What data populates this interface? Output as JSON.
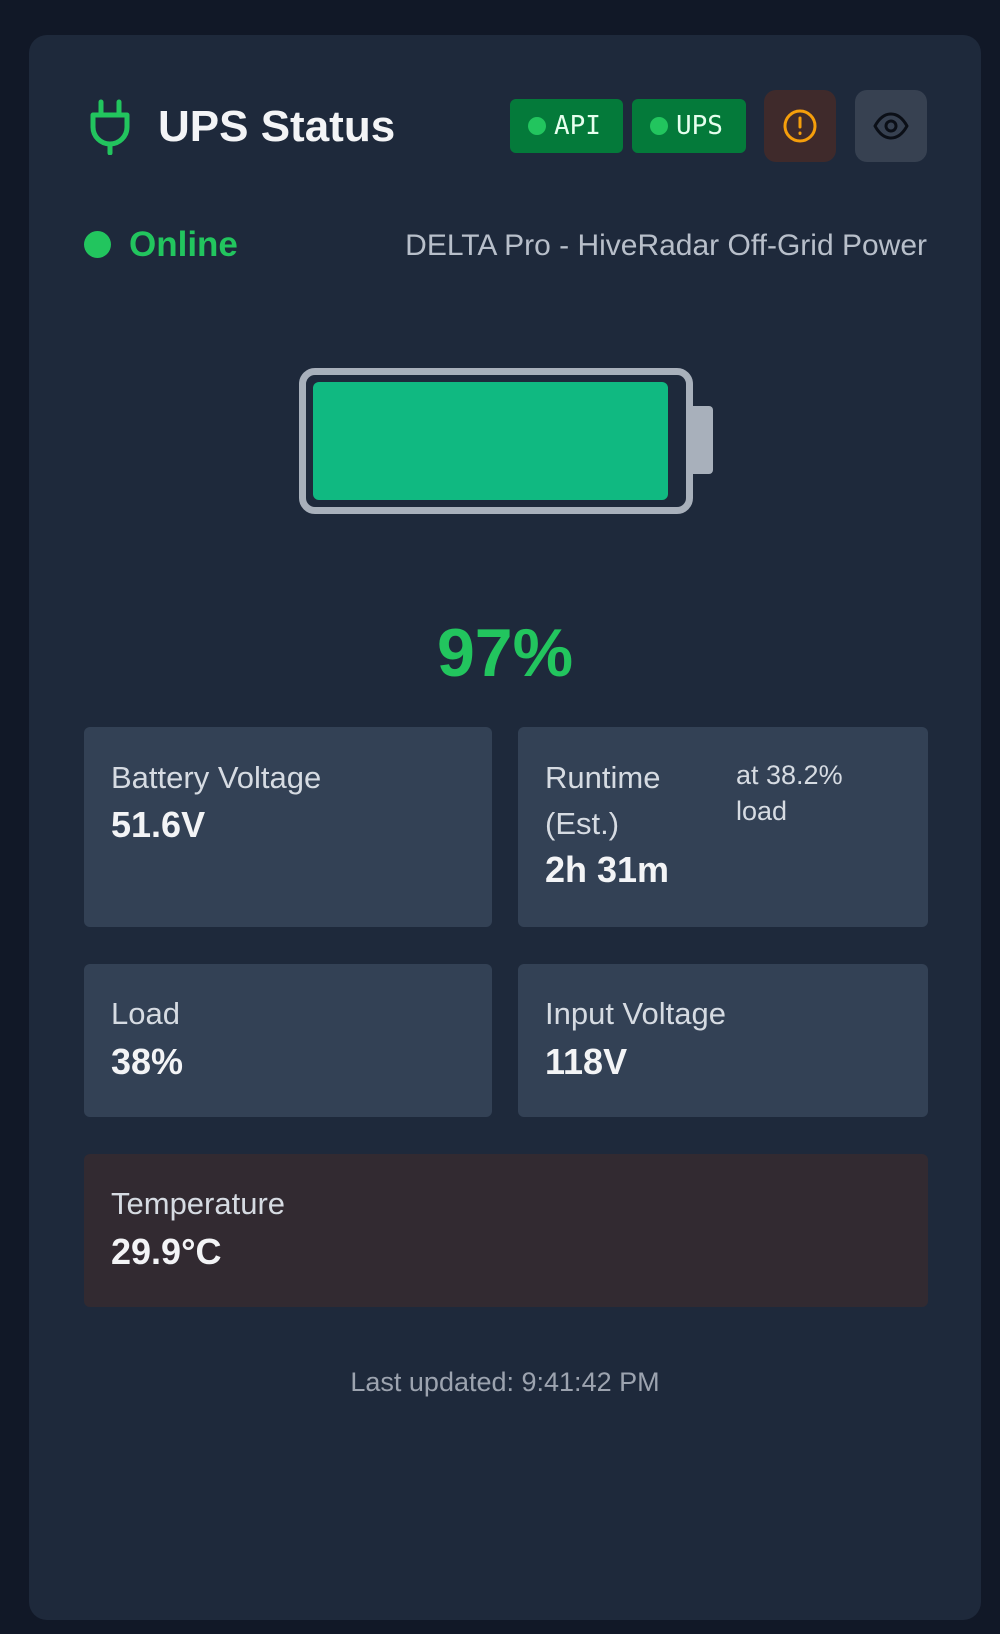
{
  "header": {
    "title": "UPS Status",
    "icon": "plug-icon",
    "badges": [
      {
        "label": "API",
        "status_color": "#22c55e"
      },
      {
        "label": "UPS",
        "status_color": "#22c55e"
      }
    ],
    "warning_icon": "alert-circle-icon",
    "visibility_icon": "eye-icon"
  },
  "status": {
    "state": "Online",
    "device": "DELTA Pro - HiveRadar Off-Grid Power",
    "color": "#22c55e"
  },
  "battery": {
    "charge_fraction": 0.97,
    "percent_label": "97%",
    "fill_color": "#10b981"
  },
  "stats": {
    "battery_voltage": {
      "label": "Battery Voltage",
      "value": "51.6V"
    },
    "runtime": {
      "label": "Runtime (Est.)",
      "value": "2h 31m",
      "note": "at 38.2% load"
    },
    "load": {
      "label": "Load",
      "value": "38%"
    },
    "input_voltage": {
      "label": "Input Voltage",
      "value": "118V"
    },
    "temperature": {
      "label": "Temperature",
      "value": "29.9°C"
    }
  },
  "footer": {
    "last_updated": "Last updated: 9:41:42 PM"
  }
}
